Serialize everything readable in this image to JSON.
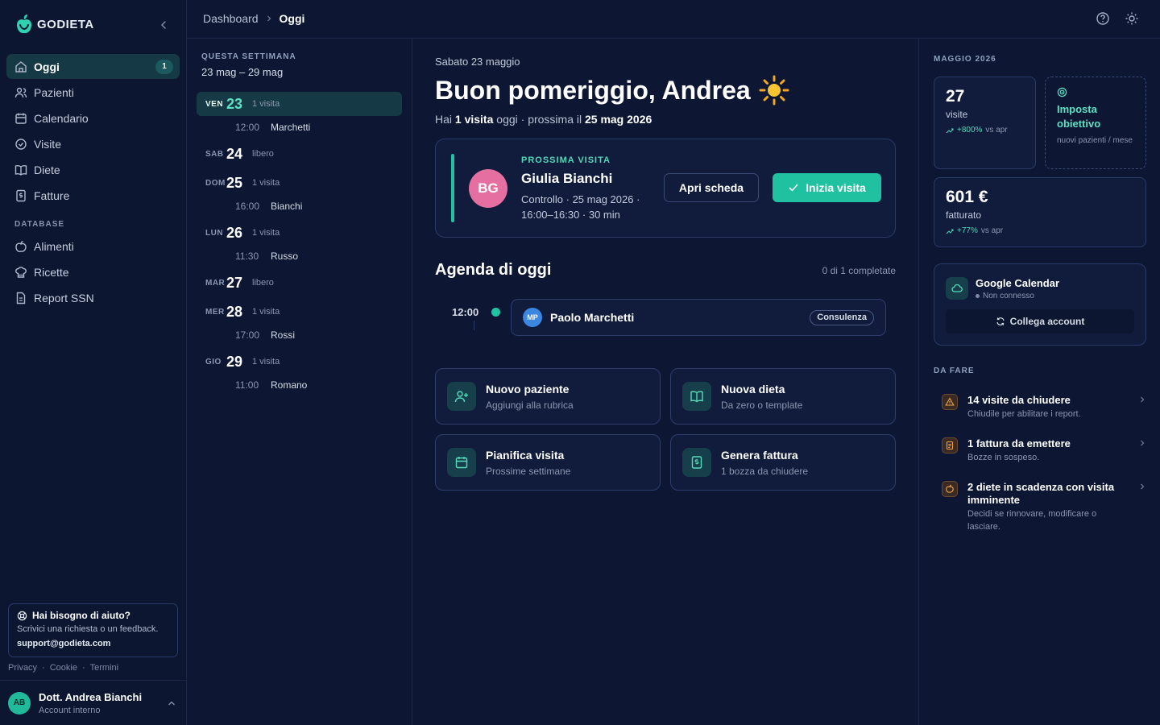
{
  "app": {
    "name": "GODIETA"
  },
  "sidebar": {
    "items": [
      {
        "label": "Oggi",
        "badge": "1"
      },
      {
        "label": "Pazienti"
      },
      {
        "label": "Calendario"
      },
      {
        "label": "Visite"
      },
      {
        "label": "Diete"
      },
      {
        "label": "Fatture"
      }
    ],
    "section": "DATABASE",
    "db_items": [
      {
        "label": "Alimenti"
      },
      {
        "label": "Ricette"
      },
      {
        "label": "Report SSN"
      }
    ],
    "help": {
      "title": "Hai bisogno di aiuto?",
      "text": "Scrivici una richiesta o un feedback.",
      "email": "support@godieta.com"
    },
    "legal": [
      "Privacy",
      "Cookie",
      "Termini"
    ],
    "user": {
      "initials": "AB",
      "name": "Dott. Andrea Bianchi",
      "role": "Account interno"
    }
  },
  "breadcrumb": {
    "parent": "Dashboard",
    "current": "Oggi"
  },
  "week": {
    "label": "QUESTA SETTIMANA",
    "range": "23 mag – 29 mag",
    "days": [
      {
        "dow": "VEN",
        "num": "23",
        "info": "1 visita",
        "appt_time": "12:00",
        "appt_name": "Marchetti"
      },
      {
        "dow": "SAB",
        "num": "24",
        "info": "libero"
      },
      {
        "dow": "DOM",
        "num": "25",
        "info": "1 visita",
        "appt_time": "16:00",
        "appt_name": "Bianchi"
      },
      {
        "dow": "LUN",
        "num": "26",
        "info": "1 visita",
        "appt_time": "11:30",
        "appt_name": "Russo"
      },
      {
        "dow": "MAR",
        "num": "27",
        "info": "libero"
      },
      {
        "dow": "MER",
        "num": "28",
        "info": "1 visita",
        "appt_time": "17:00",
        "appt_name": "Rossi"
      },
      {
        "dow": "GIO",
        "num": "29",
        "info": "1 visita",
        "appt_time": "11:00",
        "appt_name": "Romano"
      }
    ]
  },
  "main": {
    "date": "Sabato 23 maggio",
    "greeting": "Buon pomeriggio, Andrea",
    "summary_pre": "Hai ",
    "summary_count": "1 visita",
    "summary_mid": " oggi · prossima il ",
    "summary_date": "25 mag 2026",
    "next_visit": {
      "label": "PROSSIMA VISITA",
      "initials": "BG",
      "name": "Giulia Bianchi",
      "detail": "Controllo · 25 mag 2026 · 16:00–16:30 · 30 min",
      "open_label": "Apri scheda",
      "start_label": "Inizia visita"
    },
    "agenda": {
      "title": "Agenda di oggi",
      "count": "0 di 1 completate",
      "items": [
        {
          "time": "12:00",
          "initials": "MP",
          "name": "Paolo Marchetti",
          "tag": "Consulenza"
        }
      ]
    },
    "quick_actions": [
      {
        "title": "Nuovo paziente",
        "sub": "Aggiungi alla rubrica",
        "icon": "user-plus-icon"
      },
      {
        "title": "Nuova dieta",
        "sub": "Da zero o template",
        "icon": "book-icon"
      },
      {
        "title": "Pianifica visita",
        "sub": "Prossime settimane",
        "icon": "calendar-icon"
      },
      {
        "title": "Genera fattura",
        "sub": "1 bozza da chiudere",
        "icon": "invoice-icon"
      }
    ]
  },
  "right": {
    "month_label": "MAGGIO 2026",
    "stats": [
      {
        "value": "27",
        "label": "visite",
        "trend": "+800%",
        "vs": "vs apr"
      },
      {
        "value": "601 €",
        "label": "fatturato",
        "trend": "+77%",
        "vs": "vs apr"
      }
    ],
    "goal": {
      "title": "Imposta obiettivo",
      "sub": "nuovi pazienti / mese"
    },
    "gcal": {
      "title": "Google Calendar",
      "status": "Non connesso",
      "button": "Collega account"
    },
    "todo_label": "DA FARE",
    "todos": [
      {
        "title": "14 visite da chiudere",
        "sub": "Chiudile per abilitare i report."
      },
      {
        "title": "1 fattura da emettere",
        "sub": "Bozze in sospeso."
      },
      {
        "title": "2 diete in scadenza con visita imminente",
        "sub": "Decidi se rinnovare, modificare o lasciare."
      }
    ]
  },
  "colors": {
    "accent": "#1fc1a1",
    "background": "#0d1733",
    "warning": "#f0a34a"
  }
}
